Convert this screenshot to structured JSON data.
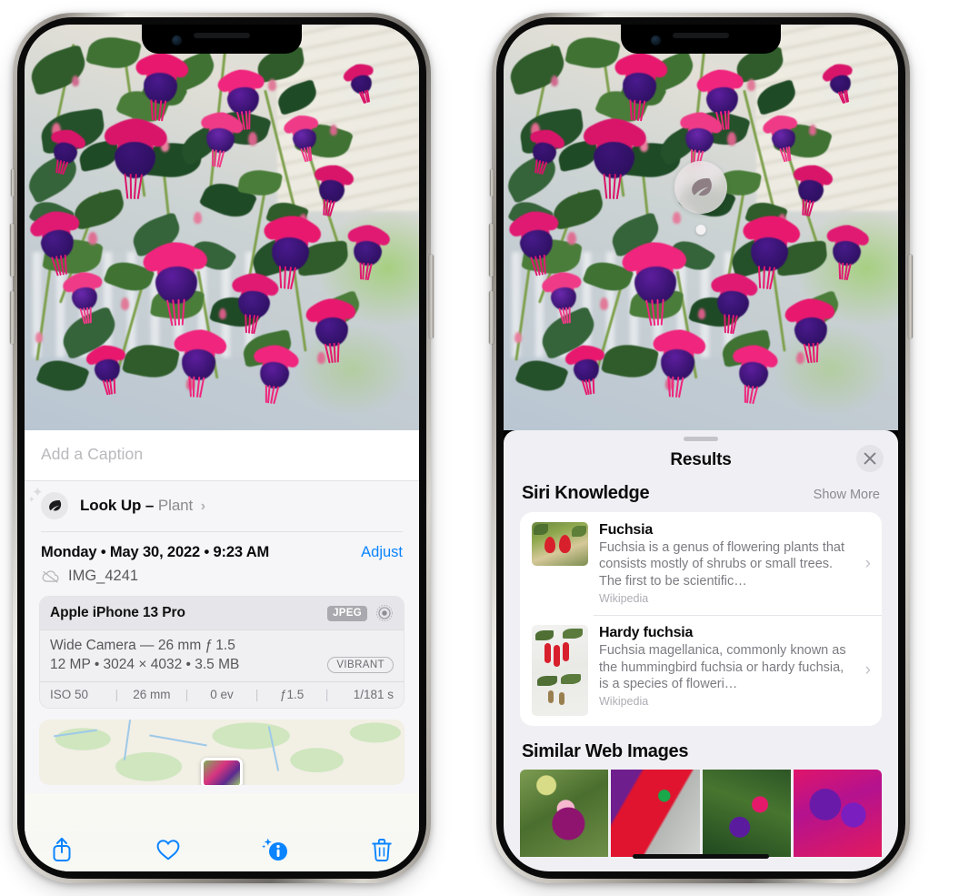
{
  "left_phone": {
    "name": "photo-details-screen",
    "caption": {
      "placeholder": "Add a Caption",
      "value": ""
    },
    "lookup": {
      "label": "Look Up",
      "dash": "–",
      "category": "Plant",
      "chevron": "›",
      "icon": "leaf-icon"
    },
    "meta": {
      "date": "Monday • May 30, 2022 • 9:23 AM",
      "adjust_label": "Adjust",
      "filename": "IMG_4241",
      "cloud_icon": "icloud-slash-icon"
    },
    "camera_card": {
      "device": "Apple iPhone 13 Pro",
      "format_badge": "JPEG",
      "hdr_icon": "aperture-icon",
      "lens": "Wide Camera — 26 mm ƒ 1.5",
      "specs": "12 MP • 3024 × 4032 • 3.5 MB",
      "style_badge": "VIBRANT",
      "exif": [
        {
          "name": "iso",
          "value": "ISO 50"
        },
        {
          "name": "focal-length",
          "value": "26 mm"
        },
        {
          "name": "exposure-value",
          "value": "0 ev"
        },
        {
          "name": "aperture",
          "value": "ƒ1.5"
        },
        {
          "name": "shutter-speed",
          "value": "1/181 s"
        }
      ],
      "exif_separator": "|"
    },
    "map": {
      "name": "location-map"
    },
    "toolbar": [
      {
        "name": "share-button",
        "icon": "share-icon"
      },
      {
        "name": "favorite-button",
        "icon": "heart-icon"
      },
      {
        "name": "info-button",
        "icon": "info-sparkle-icon"
      },
      {
        "name": "delete-button",
        "icon": "trash-icon"
      }
    ]
  },
  "right_phone": {
    "name": "visual-look-up-results-screen",
    "photo_badge": {
      "icon": "leaf-icon",
      "name": "visual-look-up-badge"
    },
    "sheet": {
      "title": "Results",
      "close_icon": "close-icon",
      "sections": [
        {
          "name": "siri-knowledge",
          "title": "Siri Knowledge",
          "action_label": "Show More",
          "items": [
            {
              "title": "Fuchsia",
              "description": "Fuchsia is a genus of flowering plants that consists mostly of shrubs or small trees. The first to be scientific…",
              "source": "Wikipedia",
              "chevron": "›"
            },
            {
              "title": "Hardy fuchsia",
              "description": "Fuchsia magellanica, commonly known as the hummingbird fuchsia or hardy fuchsia, is a species of floweri…",
              "source": "Wikipedia",
              "chevron": "›"
            }
          ]
        },
        {
          "name": "similar-web-images",
          "title": "Similar Web Images",
          "tiles": [
            {
              "name": "web-image-1"
            },
            {
              "name": "web-image-2"
            },
            {
              "name": "web-image-3"
            },
            {
              "name": "web-image-4"
            }
          ]
        }
      ]
    }
  },
  "colors": {
    "accent_blue": "#0a84ff",
    "sheet_bg": "#f0f0f4",
    "card_bg": "#ffffff",
    "text_primary": "#0b0b0c",
    "text_secondary": "#7b7b82",
    "badge_gray": "#a9a9af"
  }
}
